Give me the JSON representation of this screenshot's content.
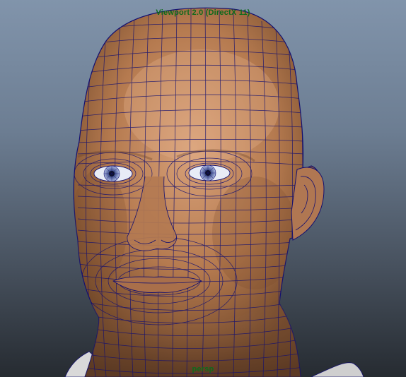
{
  "viewport": {
    "renderer_label": "Viewport 2.0 (DirectX 11)",
    "camera_name": "persp",
    "label_color": "#0f6a1c",
    "background_top": "#8194ab",
    "background_bottom": "#262b31",
    "shading_mode": "smooth shaded with wireframe on shaded",
    "wireframe_color": "#141070",
    "skin_color": "#c98b5e",
    "eye_color": "#7d8fc8"
  },
  "scene_objects": {
    "head_mesh": "head-mesh",
    "left_eye": "eye-left",
    "right_eye": "eye-right",
    "ear": "ear-right",
    "shirt": "shirt-collar"
  }
}
